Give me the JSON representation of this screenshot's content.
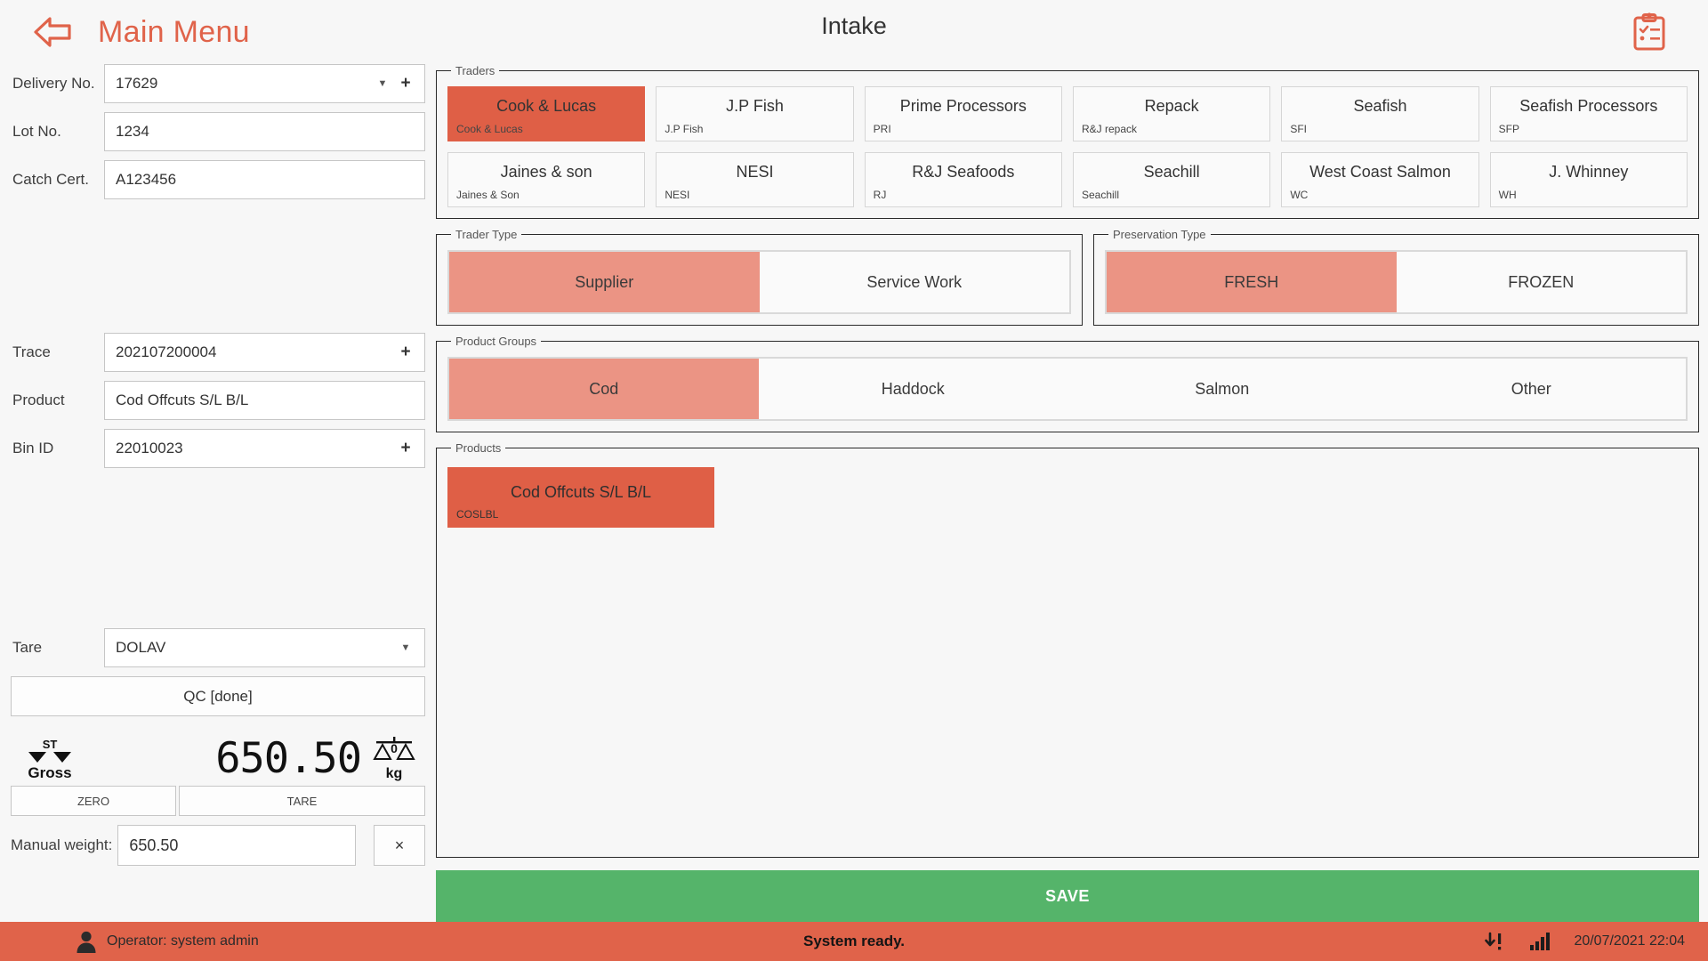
{
  "header": {
    "back_icon": "back-arrow-icon",
    "menu_label": "Main Menu",
    "title": "Intake",
    "right_icon": "clipboard-checklist-icon",
    "accent_color": "#e0634a"
  },
  "left": {
    "delivery": {
      "label": "Delivery No.",
      "value": "17629"
    },
    "lot": {
      "label": "Lot No.",
      "value": "1234"
    },
    "catch_cert": {
      "label": "Catch Cert.",
      "value": "A123456"
    },
    "trace": {
      "label": "Trace",
      "value": "202107200004"
    },
    "product": {
      "label": "Product",
      "value": "Cod Offcuts S/L B/L"
    },
    "bin_id": {
      "label": "Bin ID",
      "value": "22010023"
    },
    "tare": {
      "label": "Tare",
      "value": "DOLAV"
    },
    "qc_button": "QC [done]",
    "scale": {
      "stability": "ST",
      "mode": "Gross",
      "weight": "650.50",
      "zero_marker": "0",
      "unit": "kg",
      "zero_button": "ZERO",
      "tare_button": "TARE"
    },
    "manual": {
      "label": "Manual weight:",
      "value": "650.50",
      "clear": "×"
    }
  },
  "traders": {
    "legend": "Traders",
    "items": [
      {
        "name": "Cook & Lucas",
        "code": "Cook & Lucas",
        "selected": true
      },
      {
        "name": "J.P Fish",
        "code": "J.P Fish",
        "selected": false
      },
      {
        "name": "Prime Processors",
        "code": "PRI",
        "selected": false
      },
      {
        "name": "Repack",
        "code": "R&J repack",
        "selected": false
      },
      {
        "name": "Seafish",
        "code": "SFI",
        "selected": false
      },
      {
        "name": "Seafish Processors",
        "code": "SFP",
        "selected": false
      },
      {
        "name": "Jaines & son",
        "code": "Jaines & Son",
        "selected": false
      },
      {
        "name": "NESI",
        "code": "NESI",
        "selected": false
      },
      {
        "name": "R&J Seafoods",
        "code": "RJ",
        "selected": false
      },
      {
        "name": "Seachill",
        "code": "Seachill",
        "selected": false
      },
      {
        "name": "West Coast Salmon",
        "code": "WC",
        "selected": false
      },
      {
        "name": "J. Whinney",
        "code": "WH",
        "selected": false
      }
    ]
  },
  "trader_type": {
    "legend": "Trader Type",
    "options": [
      {
        "label": "Supplier",
        "selected": true
      },
      {
        "label": "Service Work",
        "selected": false
      }
    ]
  },
  "preservation_type": {
    "legend": "Preservation Type",
    "options": [
      {
        "label": "FRESH",
        "selected": true
      },
      {
        "label": "FROZEN",
        "selected": false
      }
    ]
  },
  "product_groups": {
    "legend": "Product Groups",
    "options": [
      {
        "label": "Cod",
        "selected": true
      },
      {
        "label": "Haddock",
        "selected": false
      },
      {
        "label": "Salmon",
        "selected": false
      },
      {
        "label": "Other",
        "selected": false
      }
    ]
  },
  "products": {
    "legend": "Products",
    "items": [
      {
        "name": "Cod Offcuts S/L B/L",
        "code": "COSLBL",
        "selected": true
      }
    ]
  },
  "save": {
    "label": "SAVE",
    "color": "#55b46a"
  },
  "statusbar": {
    "user_icon": "user-icon",
    "operator": "Operator: system admin",
    "system_status": "System ready.",
    "download_icon": "download-alert-icon",
    "signal_icon": "signal-bars-icon",
    "datetime": "20/07/2021 22:04",
    "background": "#e0634a"
  }
}
